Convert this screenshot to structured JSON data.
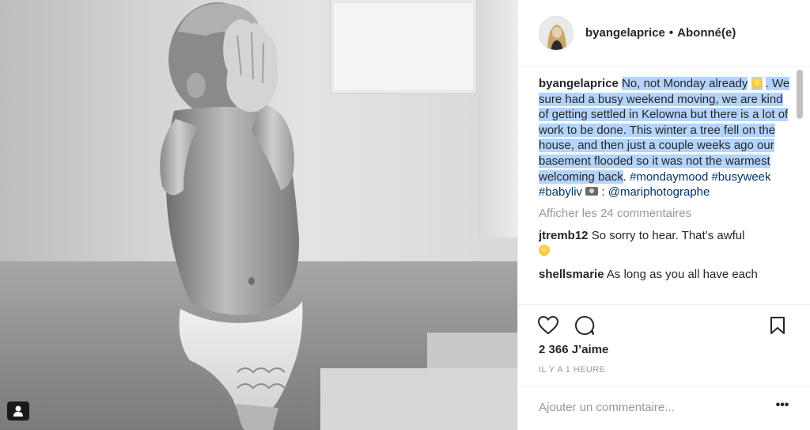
{
  "post": {
    "author": "byangelaprice",
    "separator": "•",
    "follow_status": "Abonné(e)"
  },
  "caption": {
    "user": "byangelaprice",
    "text_highlighted_1": "No, not Monday already",
    "text_highlighted_2": ". We sure had a busy weekend moving, we are kind of getting settled in Kelowna but there is a lot of work to be done. This winter a tree fell on the house, and then just a couple weeks ago our basement flooded so it was not the warmest welcoming back",
    "after_period": ".",
    "hashtag_1": "#mondaymood",
    "hashtag_2": "#busyweek",
    "hashtag_3": "#babyliv",
    "photo_credit_sep": ":",
    "mention": "@mariphotographe"
  },
  "view_all_comments": "Afficher les 24 commentaires",
  "comments": [
    {
      "user": "jtremb12",
      "text": "So sorry to hear. That’s awful"
    },
    {
      "user": "shellsmarie",
      "text": "As long as you all have each"
    }
  ],
  "likes": "2 366 J’aime",
  "timestamp": "IL Y A 1 HEURE",
  "add_comment": {
    "placeholder": "Ajouter un commentaire...",
    "more_label": "•••"
  },
  "icons": {
    "like": "heart-icon",
    "comment": "comment-bubble-icon",
    "save": "bookmark-icon",
    "user_tag": "person-tag-icon"
  },
  "colors": {
    "text": "#262626",
    "muted": "#999999",
    "hashtag": "#003569",
    "selection": "#b3d4fd"
  }
}
